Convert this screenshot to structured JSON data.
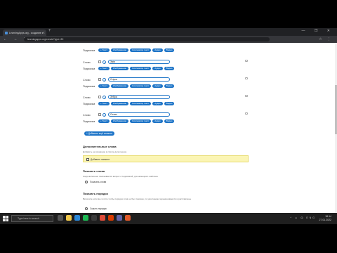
{
  "browser": {
    "tab_title": "LearningApps.org - создание мультимедийных",
    "url": "learningapps.org/create?type=30",
    "new_tab": "+",
    "window_controls": "— ❐ ✕",
    "nav": "← → ↻"
  },
  "rows": [
    {
      "label": "Подсказка",
      "word": "",
      "actions": [
        "+ Текст",
        "Изображение",
        "Синтезатор текст",
        "Аудио",
        "Видео"
      ]
    },
    {
      "label": "Слово",
      "word": "Змія",
      "actions": []
    },
    {
      "label": "Подсказка",
      "word": "",
      "actions": [
        "+ Текст",
        "Изображение",
        "Синтезатор текст",
        "Аудио",
        "Видео"
      ]
    },
    {
      "label": "Слово",
      "word": "Огірок",
      "actions": []
    },
    {
      "label": "Подсказка",
      "word": "",
      "actions": [
        "+ Текст",
        "Изображение",
        "Синтезатор текст",
        "Аудио",
        "Видео"
      ]
    },
    {
      "label": "Слово",
      "word": "Зебра",
      "actions": []
    },
    {
      "label": "Подсказка",
      "word": "",
      "actions": [
        "+ Текст",
        "Изображение",
        "Синтезатор текст",
        "Аудио",
        "Видео"
      ]
    },
    {
      "label": "Слово",
      "word": "Ослик",
      "actions": []
    },
    {
      "label": "Подсказка",
      "word": "",
      "actions": [
        "+ Текст",
        "Изображение",
        "Синтезатор текст",
        "Аудио",
        "Видео"
      ]
    }
  ],
  "add_button": "+ Добавить ещё элемент",
  "sections": {
    "extra_title": "Дополнительные слова",
    "extra_desc": "Добавить не входящие в список дополнение",
    "extra_checkbox": "Добавить элемент",
    "show_title": "Показать слова",
    "show_desc": "Когда включено показывается вопрос с подсказкой, для немецкого шаблона",
    "show_radio": "Показать слова",
    "letters_title": "Показать порядок",
    "letters_desc": "Включите если вы хотите чтобы порядок слов не был показан, по умолчанию перемешивается и расставлены",
    "letters_radio": "Скрыть порядок"
  },
  "taskbar": {
    "search_placeholder": "Type here to search",
    "time": "18:14",
    "date": "27.01.2022",
    "tray": "^ ▭ ☊ ENG"
  },
  "colors": {
    "accent": "#1d74c7",
    "highlight": "#fbf5b4"
  }
}
